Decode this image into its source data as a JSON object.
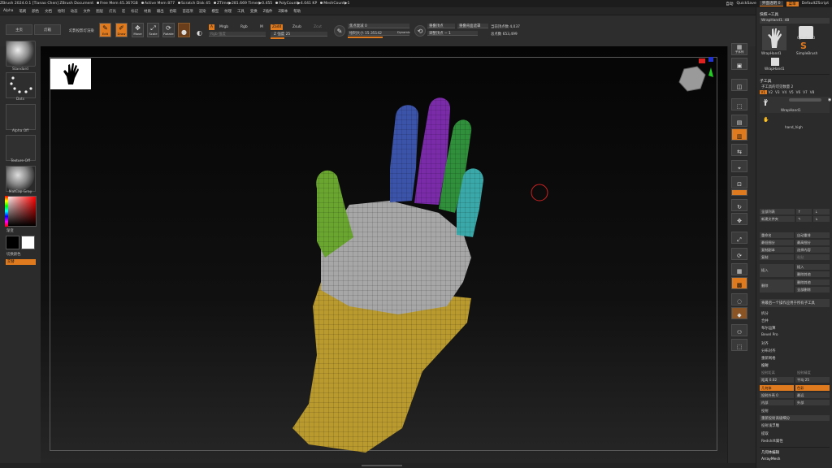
{
  "titlebar": {
    "app": "ZBrush 2024.0.1 [Tianao Chen]   ZBrush Document",
    "stats": [
      "Free Mem 45.367GB",
      "Active Mem 877",
      "Scratch Disk 45",
      "ZTime▶281.669 Timer▶0.455",
      "PolyCount▶4.041 KP",
      "MeshCount▶1"
    ],
    "right": {
      "autosave": "自动",
      "quicksave": "QuickSave",
      "transparency": "界面透明 0",
      "menus": "菜单",
      "script": "DefaultZScript"
    }
  },
  "menubar": [
    "Alpha",
    "笔刷",
    "颜色",
    "文档",
    "绘制",
    "动态",
    "文件",
    "图层",
    "灯光",
    "宏",
    "标记",
    "材质",
    "输出",
    "拾取",
    "首选项",
    "渲染",
    "模型",
    "纹理",
    "工具",
    "变换",
    "Z插件",
    "Z脚本",
    "帮助"
  ],
  "toptool": {
    "home": "主页",
    "lightbox": "灯箱",
    "spotlight": "幻影投影灯渲染",
    "edit": "Edit",
    "draw": "Draw",
    "move": "Move",
    "scale": "Scale",
    "rotate": "Rotate",
    "a_chip": "A",
    "mrgb": "Mrgb",
    "rgb": "Rgb",
    "m": "M",
    "zadd": "Zadd",
    "zsub": "Zsub",
    "zcut": "Zcut",
    "rgb_intensity": "Rgb 强度",
    "z_intensity": "Z 强度 25",
    "focal_shift": "焦点衰减 0",
    "draw_size": "绘制大小 15.35142",
    "dynamic": "Dynamic",
    "active_points": "当前顶点数 4,037",
    "total_points": "总点数 653,499",
    "front_back": "重叠顶点",
    "backface_mask": "重叠背面遮罩",
    "adjust": "调整顶点 − 1"
  },
  "leftpal": {
    "brush": "Standard",
    "stroke": "Dots",
    "alpha": "Alpha Off",
    "texture": "Texture Off",
    "material": "MatCap Gray",
    "gradient": "渐变",
    "switch_color": "切换颜色",
    "alternate": "交替"
  },
  "rshelf": [
    "子序列",
    "实际大小",
    "AAHalf",
    "透视",
    "地面",
    "地板",
    "L.Sym",
    "平移",
    "旋转",
    "缩放",
    "线框",
    "透明",
    "仅选"
  ],
  "rpanel": {
    "header": "快照→工具",
    "tool_name": "WrapHand1. 48",
    "thumbs": [
      "WrapHand1",
      "Cylinder3D",
      "WrapHand1",
      "SimpleBrush",
      "WrapHand1"
    ],
    "subtool_head": "子工具",
    "subtool_count": "子工具的可见数量 2",
    "versions": [
      "V1",
      "V2",
      "V3",
      "V4",
      "V5",
      "V6",
      "V7",
      "V8"
    ],
    "subtools": [
      "WrapHand1",
      "hand_high"
    ],
    "rows": [
      "全部列表",
      "新建文件夹",
      "重命名",
      "自动重排",
      "最低细分",
      "最高细分",
      "复制副本",
      "选择内容",
      "复制",
      "粘贴",
      "插入",
      "删除其他",
      "删除",
      "全部删除",
      "将最后一个操作应用于所有子工具",
      "拆分",
      "合并",
      "布尔运算",
      "Bevel Pro",
      "对齐",
      "分布对齐",
      "重新网格",
      "投射"
    ],
    "proj_left": "投射距离",
    "proj_right": "投射精度",
    "dist": "距离 0.02",
    "mean": "平均 25",
    "geo": "几何体",
    "color": "色彩",
    "proj_shell": "投射外壳 0",
    "farthest": "最远",
    "inner": "内部",
    "outer": "外部",
    "proj_all": "重新投射高级细分",
    "proj_bas": "投射浅浮雕",
    "extract": "提取",
    "redshift": "Redshift属性",
    "geo_edit": "几何体编辑",
    "arraymesh": "ArrayMesh"
  },
  "colors": {
    "accent": "#e07a1f",
    "panel": "#2b2b2b",
    "viewport": "#0a0a0a"
  }
}
